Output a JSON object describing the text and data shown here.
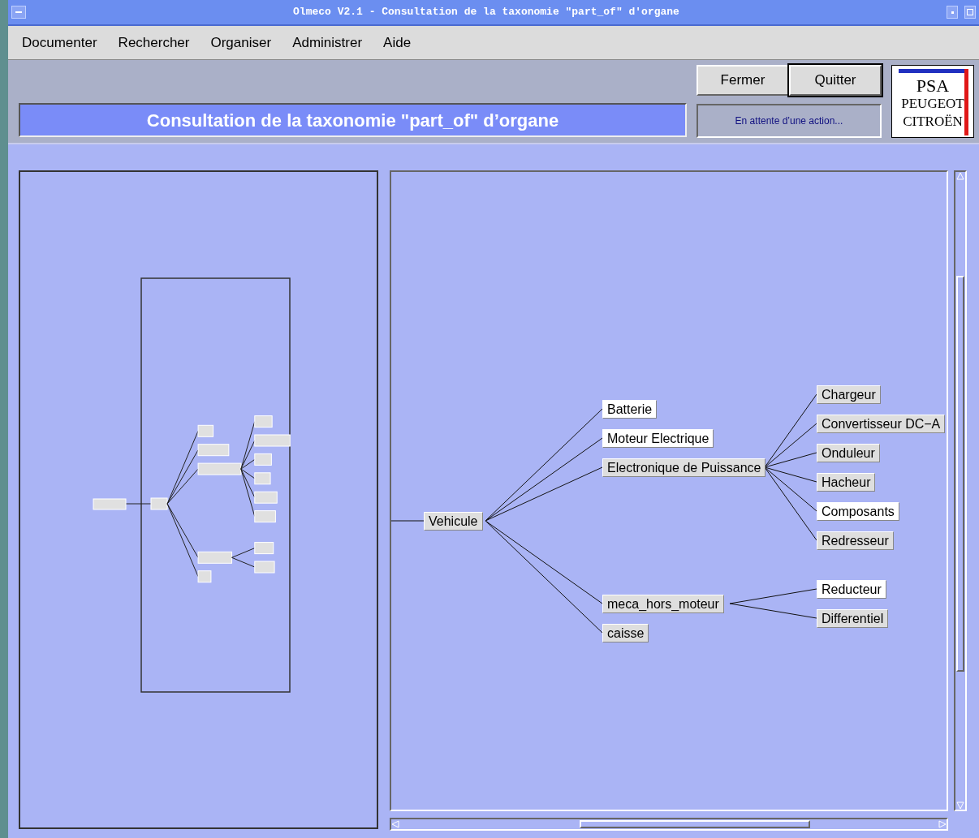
{
  "window": {
    "title": "Olmeco V2.1 - Consultation de la taxonomie \"part_of\" d'organe"
  },
  "menu": [
    "Documenter",
    "Rechercher",
    "Organiser",
    "Administrer",
    "Aide"
  ],
  "buttons": [
    "Fermer",
    "Quitter"
  ],
  "heading": "Consultation de la taxonomie \"part_of\" d’organe",
  "status": "En attente d’une action...",
  "logo": {
    "lines": [
      "PSA",
      "PEUGEOT",
      "CITROËN"
    ]
  },
  "tree": {
    "label": "Vehicule",
    "highlighted": false,
    "children": [
      {
        "label": "Batterie",
        "highlighted": true
      },
      {
        "label": "Moteur Electrique",
        "highlighted": true
      },
      {
        "label": "Electronique de Puissance",
        "highlighted": false,
        "children": [
          {
            "label": "Chargeur",
            "highlighted": false
          },
          {
            "label": "Convertisseur DC−A",
            "highlighted": false
          },
          {
            "label": "Onduleur",
            "highlighted": false
          },
          {
            "label": "Hacheur",
            "highlighted": false
          },
          {
            "label": "Composants",
            "highlighted": true
          },
          {
            "label": "Redresseur",
            "highlighted": false
          }
        ]
      },
      {
        "label": "meca_hors_moteur",
        "highlighted": false,
        "children": [
          {
            "label": "Reducteur",
            "highlighted": true
          },
          {
            "label": "Differentiel",
            "highlighted": false
          }
        ]
      },
      {
        "label": "caisse",
        "highlighted": false
      }
    ]
  }
}
